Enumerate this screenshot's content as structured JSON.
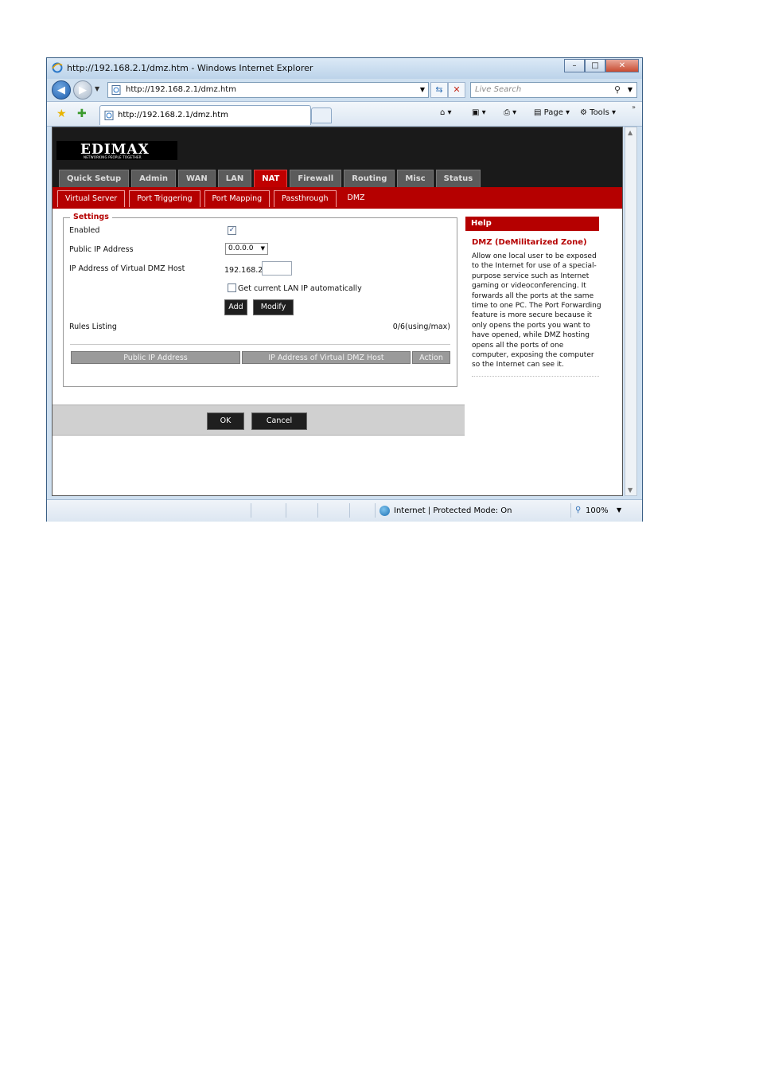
{
  "window": {
    "title": "http://192.168.2.1/dmz.htm - Windows Internet Explorer",
    "minimize": "–",
    "maximize": "□",
    "close": "✕"
  },
  "navbar": {
    "address": "http://192.168.2.1/dmz.htm",
    "search_placeholder": "Live Search"
  },
  "cmdbar": {
    "tab_label": "http://192.168.2.1/dmz.htm",
    "page_label": "Page",
    "tools_label": "Tools"
  },
  "router": {
    "brand": "EDIMAX",
    "tagline": "NETWORKING PEOPLE TOGETHER",
    "main_tabs": [
      "Quick Setup",
      "Admin",
      "WAN",
      "LAN",
      "NAT",
      "Firewall",
      "Routing",
      "Misc",
      "Status"
    ],
    "active_main_tab": "NAT",
    "sub_tabs": [
      "Virtual Server",
      "Port Triggering",
      "Port Mapping",
      "Passthrough",
      "DMZ"
    ],
    "active_sub_tab": "DMZ",
    "settings": {
      "legend": "Settings",
      "enabled_label": "Enabled",
      "enabled_checked": true,
      "public_ip_label": "Public IP Address",
      "public_ip_value": "0.0.0.0",
      "dmz_host_label": "IP Address of Virtual DMZ Host",
      "dmz_host_prefix": "192.168.2.",
      "dmz_host_value": "",
      "auto_lan_label": "Get current LAN IP automatically",
      "auto_lan_checked": false,
      "add_label": "Add",
      "modify_label": "Modify",
      "rules_label": "Rules Listing",
      "rules_count": "0/6(using/max)",
      "table_headers": [
        "Public IP Address",
        "IP Address of Virtual DMZ Host",
        "Action"
      ]
    },
    "help": {
      "header": "Help",
      "title": "DMZ (DeMilitarized Zone)",
      "text": "Allow one local user to be exposed to the Internet for use of a special-purpose service such as Internet gaming or videoconferencing. It forwards all the ports at the same time to one PC. The Port Forwarding feature is more secure because it only opens the ports you want to have opened, while DMZ hosting opens all the ports of one computer, exposing the computer so the Internet can see it."
    },
    "ok_label": "OK",
    "cancel_label": "Cancel"
  },
  "statusbar": {
    "zone": "Internet | Protected Mode: On",
    "zoom": "100%"
  },
  "colors": {
    "brand_red": "#b50000",
    "tab_active": "#c00000",
    "header_dark": "#1a1a1a"
  }
}
